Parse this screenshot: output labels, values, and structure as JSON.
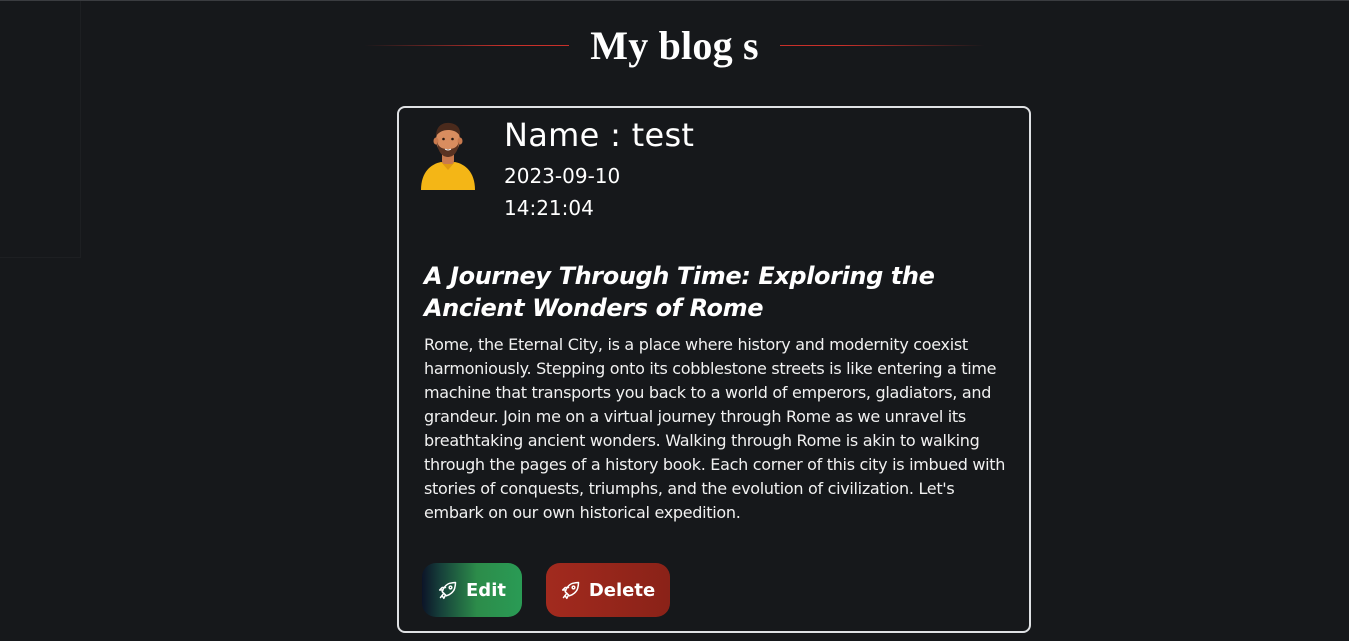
{
  "header": {
    "title": "My blog s",
    "accent_color": "#c8302a"
  },
  "post": {
    "author_label": "Name : test",
    "date": "2023-09-10",
    "time": "14:21:04",
    "title": "A Journey Through Time: Exploring the Ancient Wonders of Rome",
    "body": "Rome, the Eternal City, is a place where history and modernity coexist harmoniously. Stepping onto its cobblestone streets is like entering a time machine that transports you back to a world of emperors, gladiators, and grandeur. Join me on a virtual journey through Rome as we unravel its breathtaking ancient wonders. Walking through Rome is akin to walking through the pages of a history book. Each corner of this city is imbued with stories of conquests, triumphs, and the evolution of civilization. Let's embark on our own historical expedition.",
    "avatar_icon": "man-avatar-icon"
  },
  "actions": {
    "edit_label": "Edit",
    "delete_label": "Delete",
    "edit_icon": "rocket-icon",
    "delete_icon": "rocket-icon",
    "edit_color": "#2a9b55",
    "delete_color": "#a22a1e"
  }
}
